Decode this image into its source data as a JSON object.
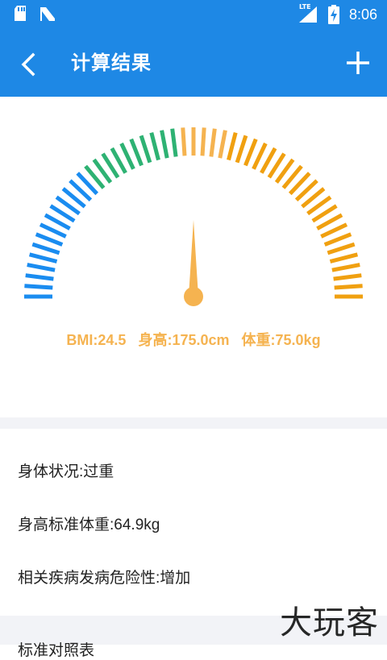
{
  "status_bar": {
    "time": "8:06",
    "network": "LTE",
    "icons": [
      "sd-card-icon",
      "notification-n-icon",
      "signal-icon",
      "battery-charging-icon"
    ]
  },
  "toolbar": {
    "title": "计算结果",
    "back_icon": "chevron-left-icon",
    "add_icon": "plus-icon",
    "color": "#1e88e5"
  },
  "gauge": {
    "bmi_value": 24.5,
    "needle_fraction": 0.5,
    "colors": {
      "low": "#1a8cf0",
      "normal": "#2eb273",
      "high_light": "#f5b350",
      "high": "#f0a010",
      "needle": "#f5b350"
    }
  },
  "results": {
    "bmi": "BMI:24.5",
    "height": "身高:175.0cm",
    "weight": "体重:75.0kg"
  },
  "info": {
    "status": "身体状况:过重",
    "standard_weight": "身高标准体重:64.9kg",
    "risk": "相关疾病发病危险性:增加"
  },
  "section": {
    "title": "标准对照表"
  },
  "watermark": "大玩客"
}
